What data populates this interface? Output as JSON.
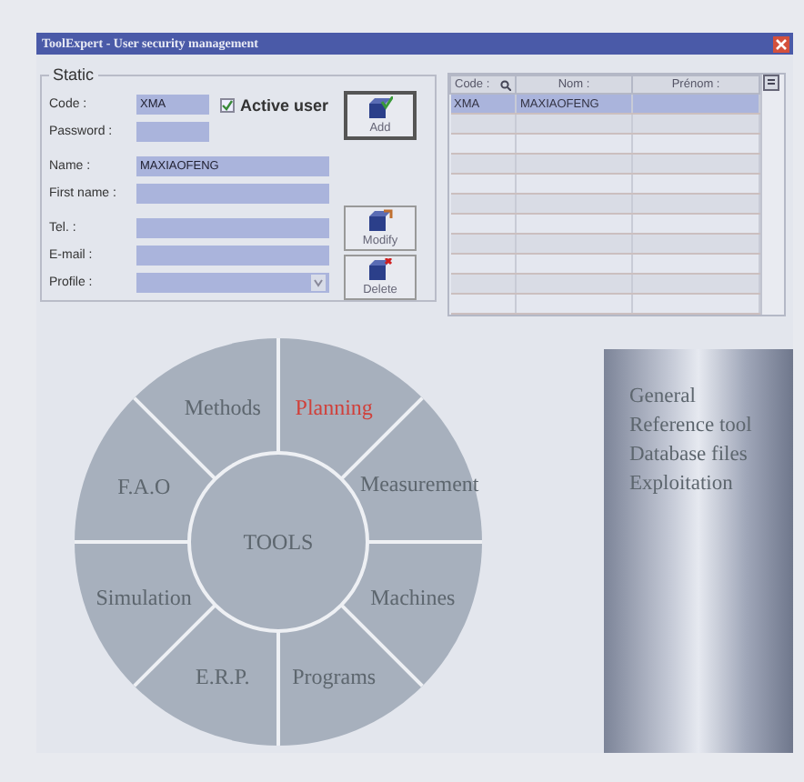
{
  "window": {
    "title": "ToolExpert - User security management"
  },
  "form": {
    "group_title": "Static",
    "fields": [
      {
        "label": "Code :",
        "value": "XMA",
        "kind": "short"
      },
      {
        "label": "Password :",
        "kind": "short"
      },
      {
        "label": "Name :",
        "value": "MAXIAOFENG",
        "kind": "long"
      },
      {
        "label": "First name :",
        "kind": "long"
      },
      {
        "label": "Tel. :",
        "kind": "long"
      },
      {
        "label": "E-mail :",
        "kind": "long"
      },
      {
        "label": "Profile :",
        "kind": "select"
      }
    ],
    "active_user": {
      "label": "Active user",
      "checked": true
    },
    "buttons": [
      "Add",
      "Modify",
      "Delete"
    ]
  },
  "grid": {
    "columns": [
      "Code :",
      "Nom :",
      "Prénom :"
    ],
    "rows": [
      {
        "cells": [
          "XMA",
          "MAXIAOFENG"
        ],
        "selected": true
      }
    ]
  },
  "wheel": {
    "center": "TOOLS",
    "segments": [
      {
        "label": "Methods",
        "selected": false
      },
      {
        "label": "Planning",
        "selected": true
      },
      {
        "label": "Measurement",
        "selected": false
      },
      {
        "label": "Machines",
        "selected": false
      },
      {
        "label": "Programs",
        "selected": false
      },
      {
        "label": "E.R.P.",
        "selected": false
      },
      {
        "label": "Simulation",
        "selected": false
      },
      {
        "label": "F.A.O",
        "selected": false
      }
    ]
  },
  "menu": {
    "items": [
      "General",
      "Reference tool",
      "Database files",
      "Exploitation"
    ]
  }
}
